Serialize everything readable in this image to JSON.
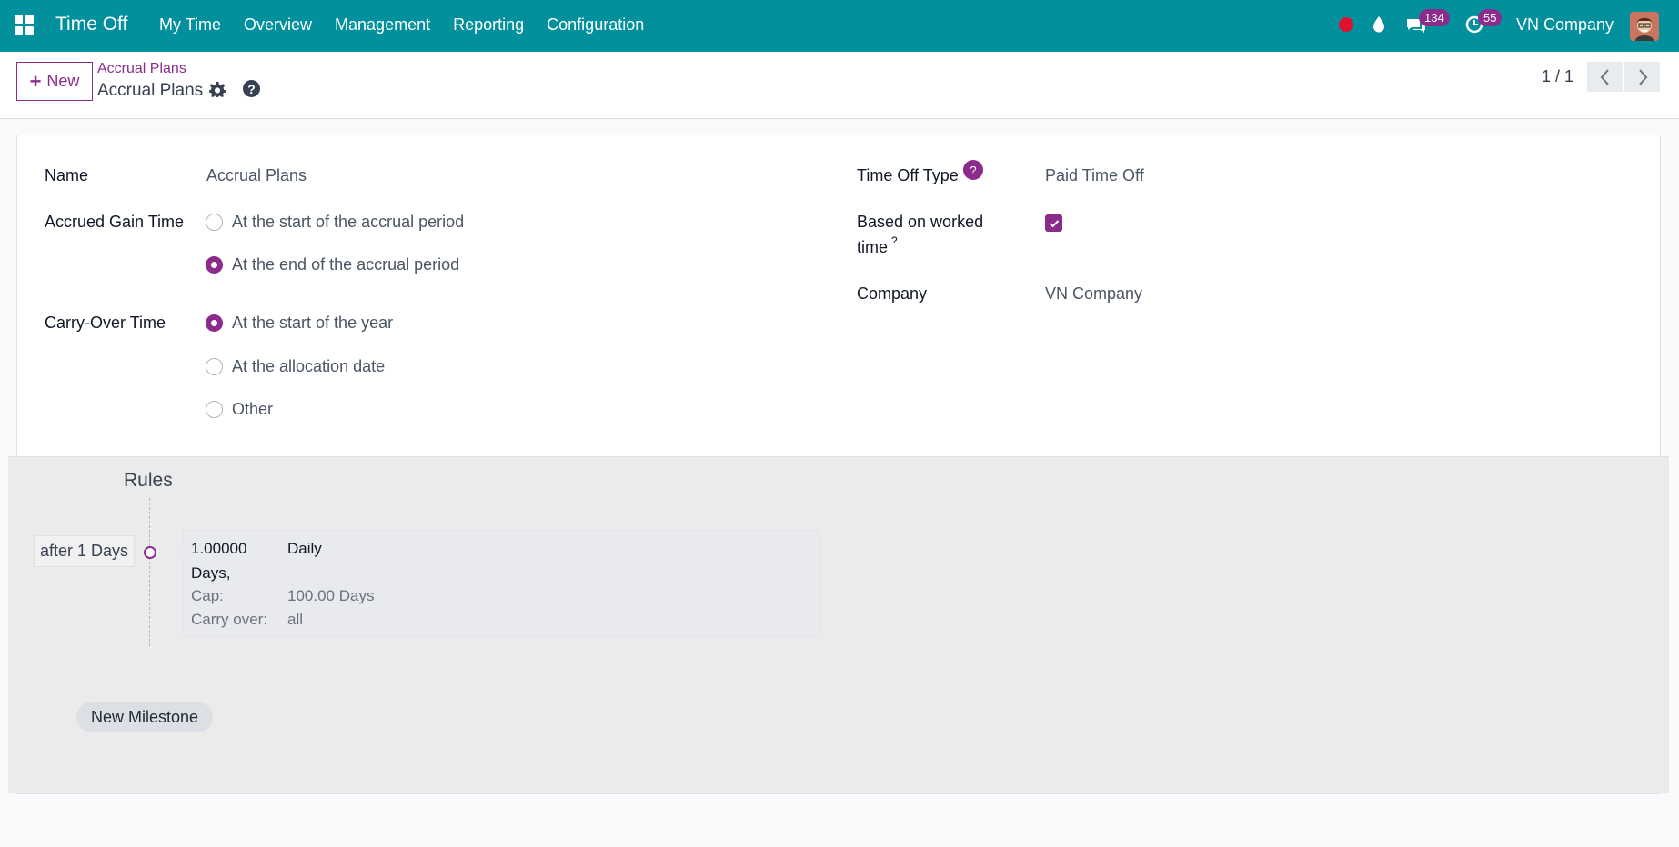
{
  "navbar": {
    "app_name": "Time Off",
    "menu": [
      "My Time",
      "Overview",
      "Management",
      "Reporting",
      "Configuration"
    ],
    "messages_count": "134",
    "activities_count": "55",
    "company": "VN Company",
    "accent_color": "#01909c"
  },
  "control_panel": {
    "new_label": "New",
    "breadcrumb_parent": "Accrual Plans",
    "breadcrumb_current": "Accrual Plans",
    "pager": "1 / 1"
  },
  "form": {
    "name_label": "Name",
    "name_value": "Accrual Plans",
    "accrued_gain_label": "Accrued Gain Time",
    "accrued_gain_options": [
      {
        "label": "At the start of the accrual period",
        "selected": false
      },
      {
        "label": "At the end of the accrual period",
        "selected": true
      }
    ],
    "carry_over_label": "Carry-Over Time",
    "carry_over_options": [
      {
        "label": "At the start of the year",
        "selected": true
      },
      {
        "label": "At the allocation date",
        "selected": false
      },
      {
        "label": "Other",
        "selected": false
      }
    ],
    "time_off_type_label": "Time Off Type",
    "time_off_type_help": "?",
    "time_off_type_value": "Paid Time Off",
    "based_on_worked_label_line1": "Based on worked",
    "based_on_worked_label_line2": "time",
    "based_on_worked_sup": "?",
    "based_on_worked_checked": true,
    "company_label": "Company",
    "company_value": "VN Company",
    "brand_color": "#8b2c8c"
  },
  "rules": {
    "title": "Rules",
    "milestone_label": "after 1 Days",
    "card": {
      "amount_line1": "1.00000",
      "amount_line2": "Days,",
      "frequency": "Daily",
      "cap_label": "Cap:",
      "cap_value": "100.00 Days",
      "carry_label": "Carry over:",
      "carry_value": "all"
    },
    "new_milestone_label": "New Milestone"
  }
}
